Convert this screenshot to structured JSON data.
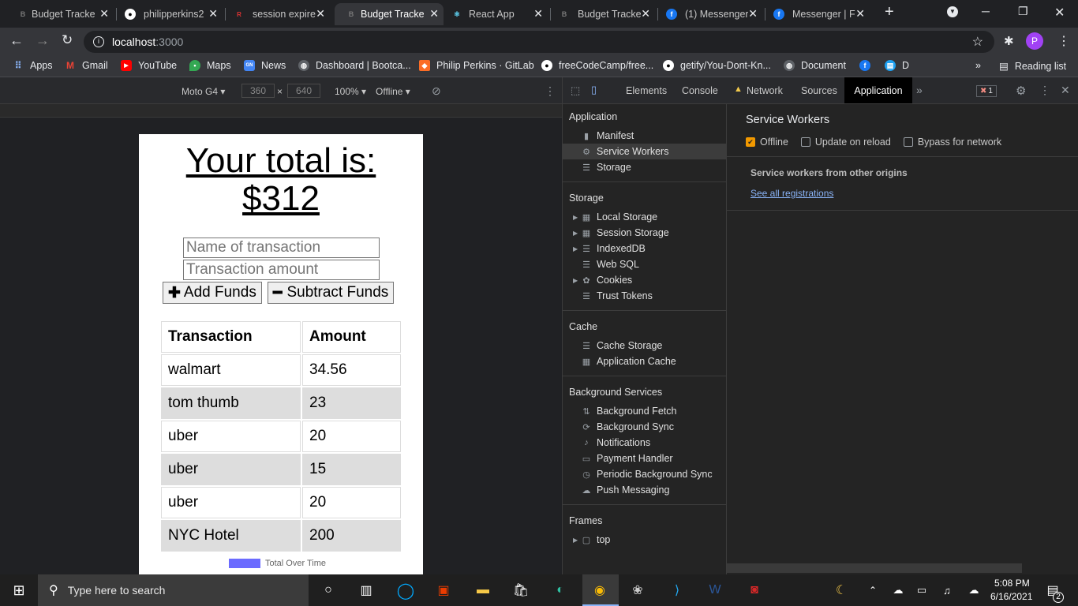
{
  "browser": {
    "tabs": [
      {
        "title": "Budget Tracke",
        "fav": "B",
        "favc": "#555"
      },
      {
        "title": "philipperkins2",
        "fav": "G",
        "favc": "#fff"
      },
      {
        "title": "session expire",
        "fav": "R",
        "favc": "#b22"
      },
      {
        "title": "Budget Tracke",
        "fav": "B",
        "favc": "#555"
      },
      {
        "title": "React App",
        "fav": "⚛",
        "favc": "#61dafb"
      },
      {
        "title": "Budget Tracke",
        "fav": "B",
        "favc": "#555"
      },
      {
        "title": "(1) Messenger",
        "fav": "f",
        "favc": "#1877f2"
      },
      {
        "title": "Messenger | F",
        "fav": "f",
        "favc": "#1877f2"
      }
    ],
    "url_host": "localhost",
    "url_port": ":3000",
    "profile_initial": "P",
    "bookmarks": [
      {
        "label": "Apps",
        "ic": "#4285f4"
      },
      {
        "label": "Gmail",
        "ic": "#ea4335",
        "t": "M"
      },
      {
        "label": "YouTube",
        "ic": "#ff0000",
        "t": "▶"
      },
      {
        "label": "Maps",
        "ic": "#34a853"
      },
      {
        "label": "News",
        "ic": "#4285f4"
      },
      {
        "label": "Dashboard | Bootca...",
        "ic": "#888"
      },
      {
        "label": "Philip Perkins · GitLab",
        "ic": "#fc6d26"
      },
      {
        "label": "freeCodeCamp/free...",
        "ic": "#fff"
      },
      {
        "label": "getify/You-Dont-Kn...",
        "ic": "#fff"
      },
      {
        "label": "Document",
        "ic": "#888"
      },
      {
        "label": "",
        "ic": "#1877f2",
        "t": "f"
      },
      {
        "label": "D",
        "ic": "#1da1f2"
      }
    ],
    "reading_list": "Reading list"
  },
  "device": {
    "name": "Moto G4",
    "width": "360",
    "height": "640",
    "zoom": "100%",
    "throttle": "Offline"
  },
  "app": {
    "total_label": "Your total is:",
    "total_value": "$312",
    "name_placeholder": "Name of transaction",
    "amount_placeholder": "Transaction amount",
    "add_label": "Add Funds",
    "sub_label": "Subtract Funds",
    "headers": [
      "Transaction",
      "Amount"
    ],
    "rows": [
      [
        "walmart",
        "34.56"
      ],
      [
        "tom thumb",
        "23"
      ],
      [
        "uber",
        "20"
      ],
      [
        "uber",
        "15"
      ],
      [
        "uber",
        "20"
      ],
      [
        "NYC Hotel",
        "200"
      ]
    ],
    "legend_label": "Total Over Time",
    "legend_color": "#6b6bff"
  },
  "devtools": {
    "tabs": [
      "Elements",
      "Console",
      "Network",
      "Sources",
      "Application"
    ],
    "error_count": "1",
    "sidebar": {
      "application_header": "Application",
      "application_items": [
        "Manifest",
        "Service Workers",
        "Storage"
      ],
      "storage_header": "Storage",
      "storage_items": [
        "Local Storage",
        "Session Storage",
        "IndexedDB",
        "Web SQL",
        "Cookies",
        "Trust Tokens"
      ],
      "cache_header": "Cache",
      "cache_items": [
        "Cache Storage",
        "Application Cache"
      ],
      "bg_header": "Background Services",
      "bg_items": [
        "Background Fetch",
        "Background Sync",
        "Notifications",
        "Payment Handler",
        "Periodic Background Sync",
        "Push Messaging"
      ],
      "frames_header": "Frames",
      "frames_items": [
        "top"
      ]
    },
    "main": {
      "title": "Service Workers",
      "opt_offline": "Offline",
      "opt_update": "Update on reload",
      "opt_bypass": "Bypass for network",
      "other_origins": "Service workers from other origins",
      "see_all": "See all registrations"
    }
  },
  "taskbar": {
    "search_placeholder": "Type here to search",
    "time": "5:08 PM",
    "date": "6/16/2021",
    "notif_count": "2"
  }
}
